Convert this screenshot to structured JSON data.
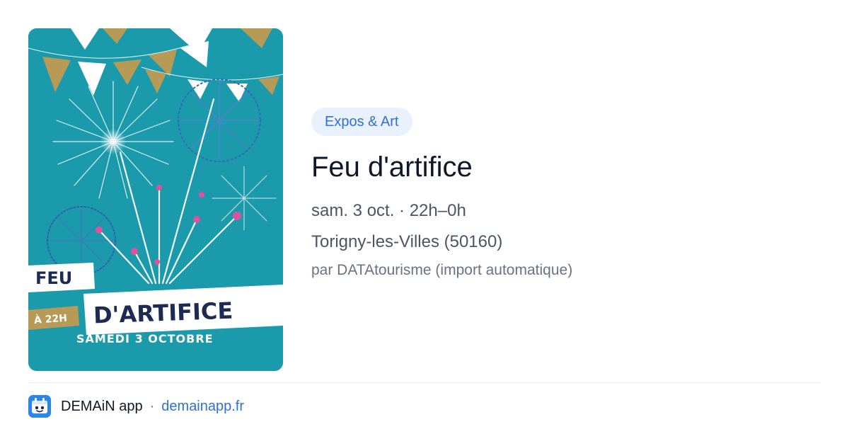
{
  "event": {
    "category": "Expos & Art",
    "title": "Feu d'artifice",
    "date": "sam. 3 oct. · 22h–0h",
    "location": "Torigny-les-Villes (50160)",
    "source": "par DATAtourisme (import automatique)"
  },
  "poster": {
    "line1": "FEU",
    "line2": "D'ARTIFICE",
    "time": "À 22H",
    "date": "SAMEDI 3 OCTOBRE"
  },
  "footer": {
    "app_name": "DEMAiN app",
    "separator": "·",
    "domain": "demainapp.fr"
  },
  "colors": {
    "poster_bg": "#1b9aac",
    "accent_blue": "#2f6fd6",
    "badge_bg": "#e8f1fc",
    "gold": "#b79a55",
    "navy": "#1d2b52"
  }
}
